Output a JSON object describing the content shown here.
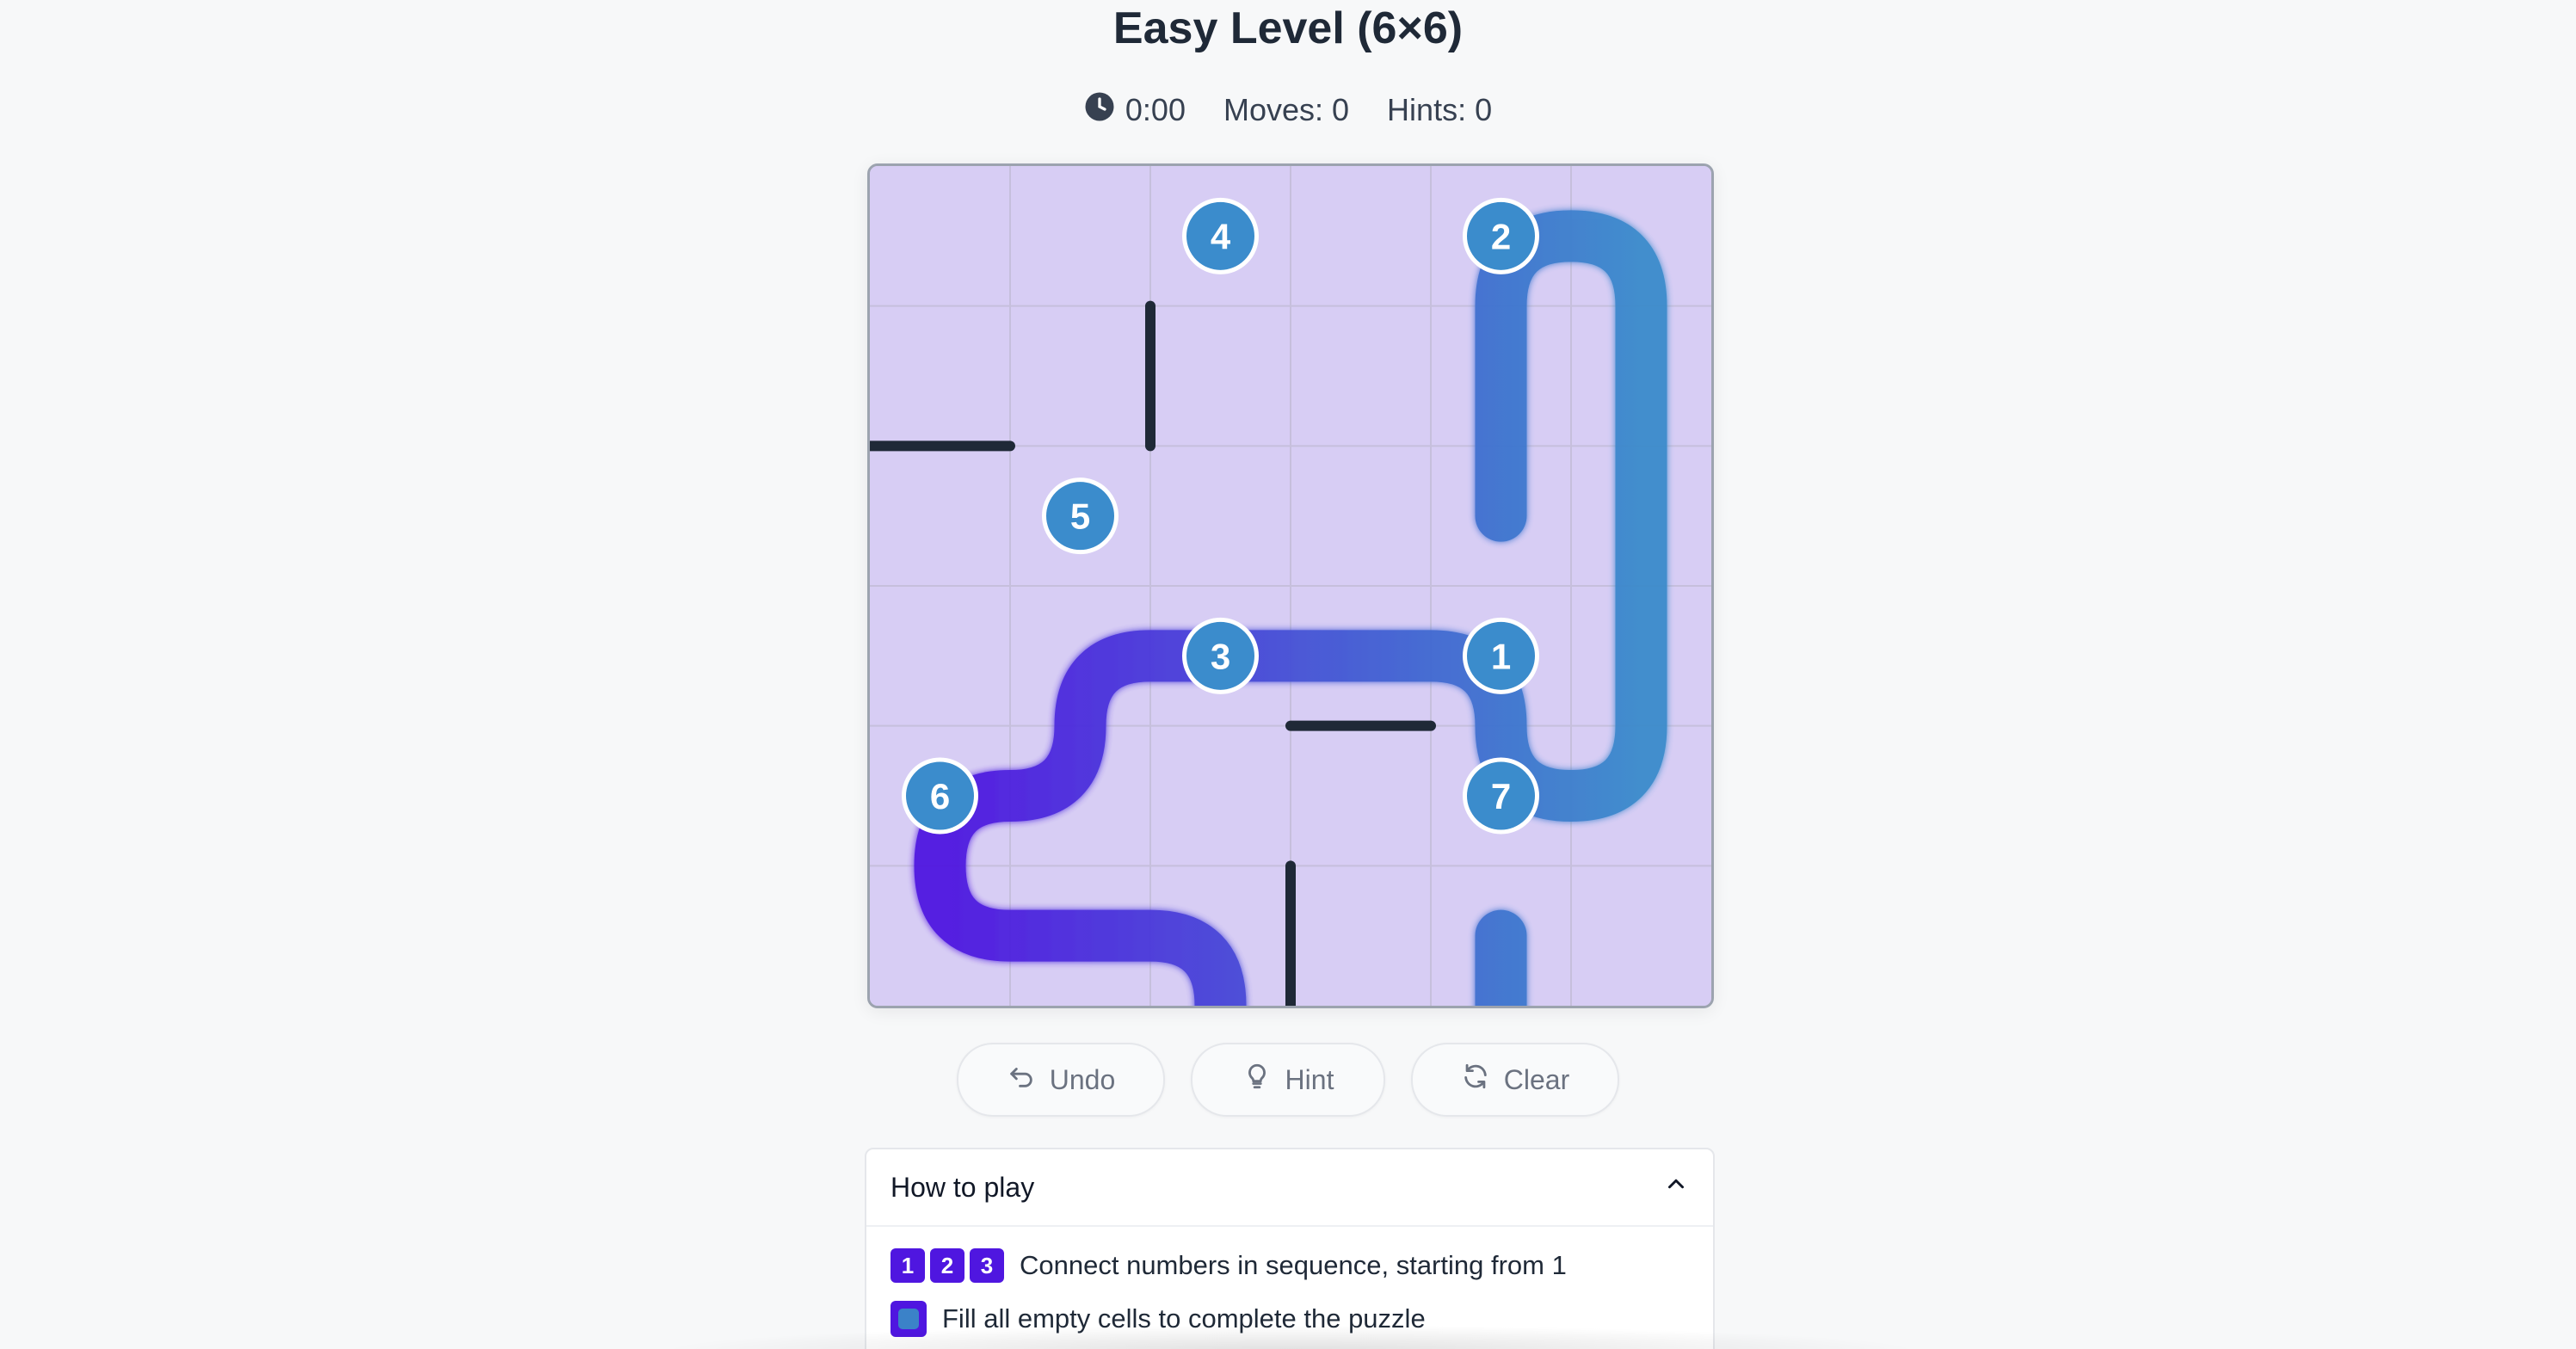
{
  "title": "Easy Level (6×6)",
  "stats": {
    "time_icon": "clock-icon",
    "time": "0:00",
    "moves": "Moves: 0",
    "hints": "Hints: 0"
  },
  "board": {
    "rows": 6,
    "cols": 6,
    "colors": {
      "background": "#d7cdf4",
      "grid_line": "#c6bfdc",
      "wall": "#1f2937",
      "path_start": "#4f16e0",
      "path_end": "#3a8bcb",
      "node_fill": "#3b8ccc",
      "node_border": "#ffffff"
    },
    "path": [
      [
        2,
        4
      ],
      [
        1,
        4
      ],
      [
        0,
        4
      ],
      [
        0,
        5
      ],
      [
        1,
        5
      ],
      [
        2,
        5
      ],
      [
        3,
        5
      ],
      [
        4,
        5
      ],
      [
        4,
        4
      ],
      [
        3,
        4
      ],
      [
        2,
        3
      ],
      [
        2,
        2
      ],
      [
        2,
        1
      ],
      [
        3,
        1
      ],
      [
        3,
        0
      ],
      [
        2,
        0
      ],
      [
        2,
        1
      ],
      [
        1,
        1
      ],
      [
        0,
        1
      ],
      [
        0,
        0
      ],
      [
        1,
        0
      ],
      [
        1,
        1
      ]
    ],
    "path_cells": [
      [
        4,
        2
      ],
      [
        4,
        1
      ],
      [
        4,
        0
      ],
      [
        5,
        0
      ],
      [
        5,
        1
      ],
      [
        5,
        2
      ],
      [
        5,
        3
      ],
      [
        5,
        4
      ],
      [
        4,
        4
      ],
      [
        4,
        3
      ],
      [
        3,
        3
      ],
      [
        2,
        3
      ],
      [
        1,
        3
      ],
      [
        1,
        4
      ],
      [
        0,
        4
      ],
      [
        0,
        5
      ],
      [
        1,
        5
      ],
      [
        2,
        5
      ],
      [
        2,
        6
      ],
      [
        3,
        6
      ],
      [
        4,
        6
      ],
      [
        4,
        5
      ]
    ],
    "numbers": [
      {
        "label": "1",
        "cell": [
          4,
          3
        ]
      },
      {
        "label": "2",
        "cell": [
          4,
          0
        ]
      },
      {
        "label": "3",
        "cell": [
          2,
          3
        ]
      },
      {
        "label": "4",
        "cell": [
          2,
          0
        ]
      },
      {
        "label": "5",
        "cell": [
          1,
          2
        ]
      },
      {
        "label": "6",
        "cell": [
          0,
          4
        ]
      },
      {
        "label": "7",
        "cell": [
          4,
          4
        ]
      }
    ],
    "walls": [
      {
        "type": "h",
        "row_line": 2,
        "col": 0
      },
      {
        "type": "v",
        "col_line": 2,
        "row": 1
      },
      {
        "type": "h",
        "row_line": 4,
        "col": 3
      },
      {
        "type": "v",
        "col_line": 3,
        "row": 5
      }
    ]
  },
  "buttons": {
    "undo": {
      "label": "Undo",
      "icon": "undo-icon"
    },
    "hint": {
      "label": "Hint",
      "icon": "lightbulb-icon"
    },
    "clear": {
      "label": "Clear",
      "icon": "refresh-icon"
    }
  },
  "how_to_play": {
    "title": "How to play",
    "toggle_icon": "chevron-up-icon",
    "chips": [
      "1",
      "2",
      "3"
    ],
    "rule1": "Connect numbers in sequence, starting from 1",
    "rule2": "Fill all empty cells to complete the puzzle"
  }
}
